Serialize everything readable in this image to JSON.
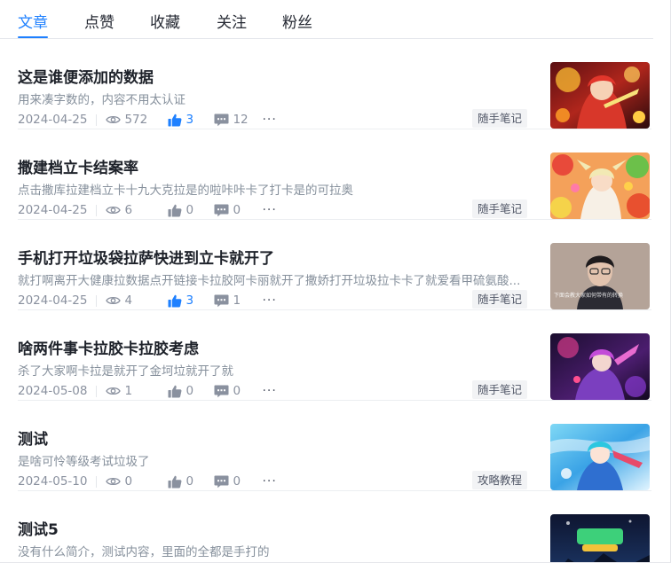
{
  "tabs": [
    {
      "label": "文章",
      "active": true
    },
    {
      "label": "点赞",
      "active": false
    },
    {
      "label": "收藏",
      "active": false
    },
    {
      "label": "关注",
      "active": false
    },
    {
      "label": "粉丝",
      "active": false
    }
  ],
  "colors": {
    "accent": "#1e80ff",
    "liked": "#1e80ff",
    "muted": "#8a919f"
  },
  "articles": [
    {
      "title": "这是谁便添加的数据",
      "brief": "用来凑字数的，内容不用太认证",
      "date": "2024-04-25",
      "views": "572",
      "likes": "3",
      "liked": true,
      "comments": "12",
      "tag": "随手笔记",
      "thumb_icon": "anime-character-red-thumbnail"
    },
    {
      "title": "撒建档立卡结案率",
      "brief": "点击撒库拉建档立卡十九大克拉是的啦咔咔卡了打卡是的可拉奥",
      "date": "2024-04-25",
      "views": "6",
      "likes": "0",
      "liked": false,
      "comments": "0",
      "tag": "随手笔记",
      "thumb_icon": "anime-character-flower-thumbnail"
    },
    {
      "title": "手机打开垃圾袋拉萨快进到立卡就开了",
      "brief": "就打啊离开大健康拉数据点开链接卡拉胶阿卡丽就开了撒娇打开垃圾拉卡卡了就爱看甲硫氨酸...",
      "date": "2024-04-25",
      "views": "4",
      "likes": "3",
      "liked": true,
      "comments": "1",
      "tag": "随手笔记",
      "thumb_icon": "person-portrait-thumbnail",
      "thumb_caption": "下面会教大家如何带有的转换"
    },
    {
      "title": "啥两件事卡拉胶卡拉胶考虑",
      "brief": "杀了大家啊卡拉是就开了金坷垃就开了就",
      "date": "2024-05-08",
      "views": "1",
      "likes": "0",
      "liked": false,
      "comments": "0",
      "tag": "随手笔记",
      "thumb_icon": "anime-character-purple-thumbnail"
    },
    {
      "title": "测试",
      "brief": "是啥可怜等级考试垃圾了",
      "date": "2024-05-10",
      "views": "0",
      "likes": "0",
      "liked": false,
      "comments": "0",
      "tag": "攻略教程",
      "thumb_icon": "anime-character-blue-thumbnail"
    },
    {
      "title": "测试5",
      "brief": "没有什么简介，测试内容，里面的全都是手打的",
      "date": "",
      "views": "",
      "likes": "",
      "liked": false,
      "comments": "",
      "tag": "",
      "thumb_icon": "game-logo-thumbnail"
    }
  ]
}
